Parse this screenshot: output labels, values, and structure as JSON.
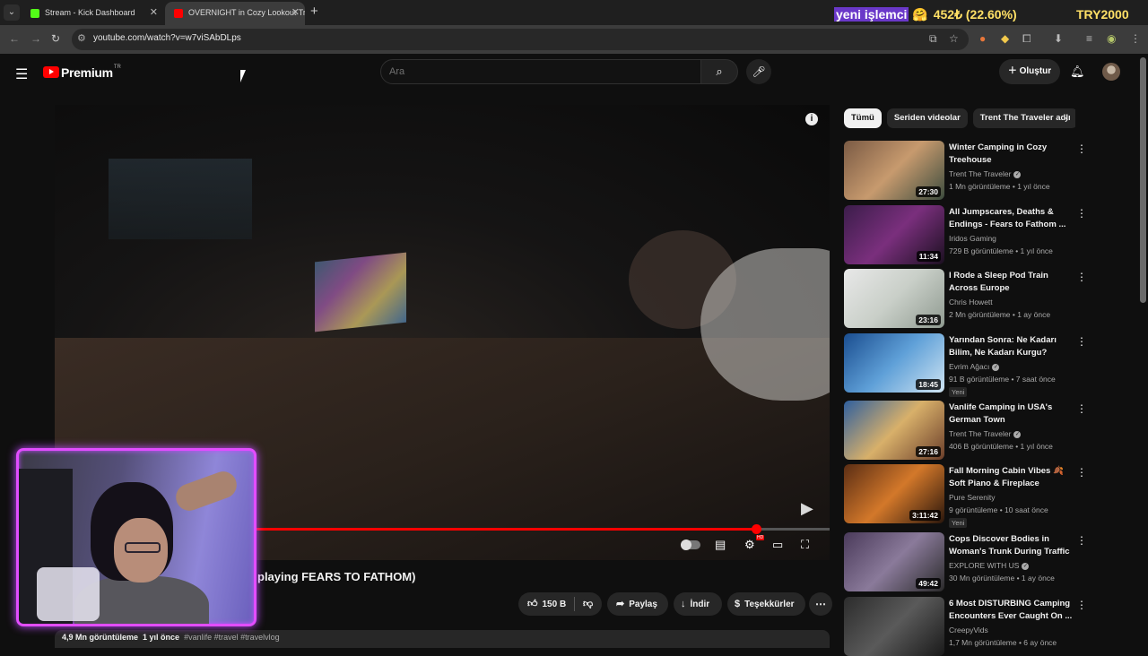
{
  "browser": {
    "tabs": [
      {
        "title": "Stream - Kick Dashboard",
        "favicon_color": "#53fc18"
      },
      {
        "title": "OVERNIGHT in Cozy Lookout Tr",
        "favicon_color": "#ff0000"
      }
    ],
    "url": "youtube.com/watch?v=w7viSAbDLps"
  },
  "ticker": {
    "highlight": "yeni işlemci",
    "value": "452₺ (22.60%)",
    "currency": "TRY2000"
  },
  "header": {
    "logo_text": "Premium",
    "logo_sup": "TR",
    "search_placeholder": "Ara",
    "create_label": "Oluştur"
  },
  "player": {
    "progress": 0.905
  },
  "video": {
    "title_partial": "playing FEARS TO FATHOM)",
    "likes": "150 B",
    "share_label": "Paylaş",
    "download_label": "İndir",
    "thanks_label": "Teşekkürler",
    "views": "4,9 Mn görüntüleme",
    "age": "1 yıl önce",
    "tags": "#vanlife #travel #travelvlog"
  },
  "chips": [
    "Tümü",
    "Seriden videolar",
    "Trent The Traveler adlı"
  ],
  "recommendations": [
    {
      "title": "Winter Camping in Cozy Treehouse",
      "channel": "Trent The Traveler",
      "verified": true,
      "meta": "1 Mn görüntüleme • 1 yıl önce",
      "duration": "27:30",
      "badge": "",
      "colors": [
        "#7a5a44",
        "#c79a6e",
        "#3c4c3e"
      ]
    },
    {
      "title": "All Jumpscares, Deaths & Endings - Fears to Fathom ...",
      "channel": "Iridos Gaming",
      "verified": false,
      "meta": "729 B görüntüleme • 1 yıl önce",
      "duration": "11:34",
      "badge": "",
      "colors": [
        "#3b1d4a",
        "#7a2f7d",
        "#1b1020"
      ]
    },
    {
      "title": "I Rode a Sleep Pod Train Across Europe",
      "channel": "Chris Howett",
      "verified": false,
      "meta": "2 Mn görüntüleme • 1 ay önce",
      "duration": "23:16",
      "badge": "",
      "colors": [
        "#e8e8e8",
        "#c9cfc8",
        "#8f9a90"
      ]
    },
    {
      "title": "Yarından Sonra: Ne Kadarı Bilim, Ne Kadarı Kurgu?",
      "channel": "Evrim Ağacı",
      "verified": true,
      "meta": "91 B görüntüleme • 7 saat önce",
      "duration": "18:45",
      "badge": "Yeni",
      "colors": [
        "#1a4d8f",
        "#5fa0d8",
        "#cfe4f2"
      ]
    },
    {
      "title": "Vanlife Camping in USA's German Town",
      "channel": "Trent The Traveler",
      "verified": true,
      "meta": "406 B görüntüleme • 1 yıl önce",
      "duration": "27:16",
      "badge": "",
      "colors": [
        "#2f5f9e",
        "#d8b06a",
        "#6b3e2a"
      ]
    },
    {
      "title": "Fall Morning Cabin Vibes 🍂 Soft Piano & Fireplace Sounds...",
      "channel": "Pure Serenity",
      "verified": false,
      "meta": "9 görüntüleme • 10 saat önce",
      "duration": "3:11:42",
      "badge": "Yeni",
      "colors": [
        "#5a2d14",
        "#d3782a",
        "#2a160c"
      ]
    },
    {
      "title": "Cops Discover Bodies in Woman's Trunk During Traffic ...",
      "channel": "EXPLORE WITH US",
      "verified": true,
      "meta": "30 Mn görüntüleme • 1 ay önce",
      "duration": "49:42",
      "badge": "",
      "colors": [
        "#4a3a5a",
        "#8a7a9a",
        "#2a2a2a"
      ]
    },
    {
      "title": "6 Most DISTURBING Camping Encounters Ever Caught On ...",
      "channel": "CreepyVids",
      "verified": false,
      "meta": "1,7 Mn görüntüleme • 6 ay önce",
      "duration": "",
      "badge": "",
      "colors": [
        "#2c2c2c",
        "#5a5a5a",
        "#1a1a1a"
      ]
    }
  ]
}
